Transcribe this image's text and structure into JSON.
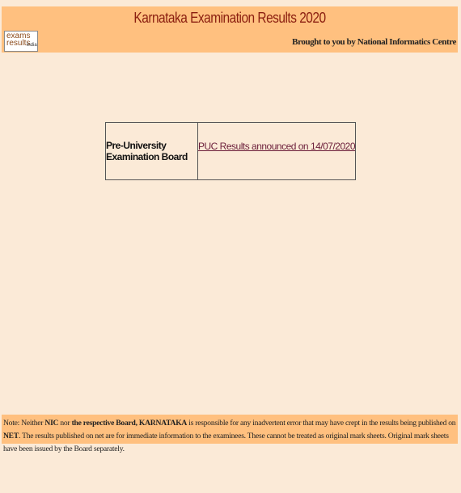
{
  "header": {
    "title": "Karnataka Examination Results 2020",
    "logo": {
      "line1": "exams",
      "line2": "results",
      "line3": "india"
    },
    "credit": "Brought to you by National Informatics Centre"
  },
  "results": {
    "board_name": "Pre-University Examination Board",
    "link_text": "PUC Results announced on 14/07/2020"
  },
  "footer_note": {
    "prefix": "Note: Neither ",
    "nic": "NIC",
    "mid1": " nor ",
    "board": "the respective Board, KARNATAKA",
    "mid2": " is responsible for any inadvertent error that may have crept in the results being published on ",
    "net": "NET",
    "suffix": ". The results published on net are for immediate information to the examinees. These cannot be treated as original mark sheets. Original mark sheets have been issued by the Board separately."
  },
  "colors": {
    "page_background": "#fbead7",
    "banner_background": "#ffc07f",
    "title_color": "#8b1f10",
    "link_color": "#6b1e3a"
  }
}
